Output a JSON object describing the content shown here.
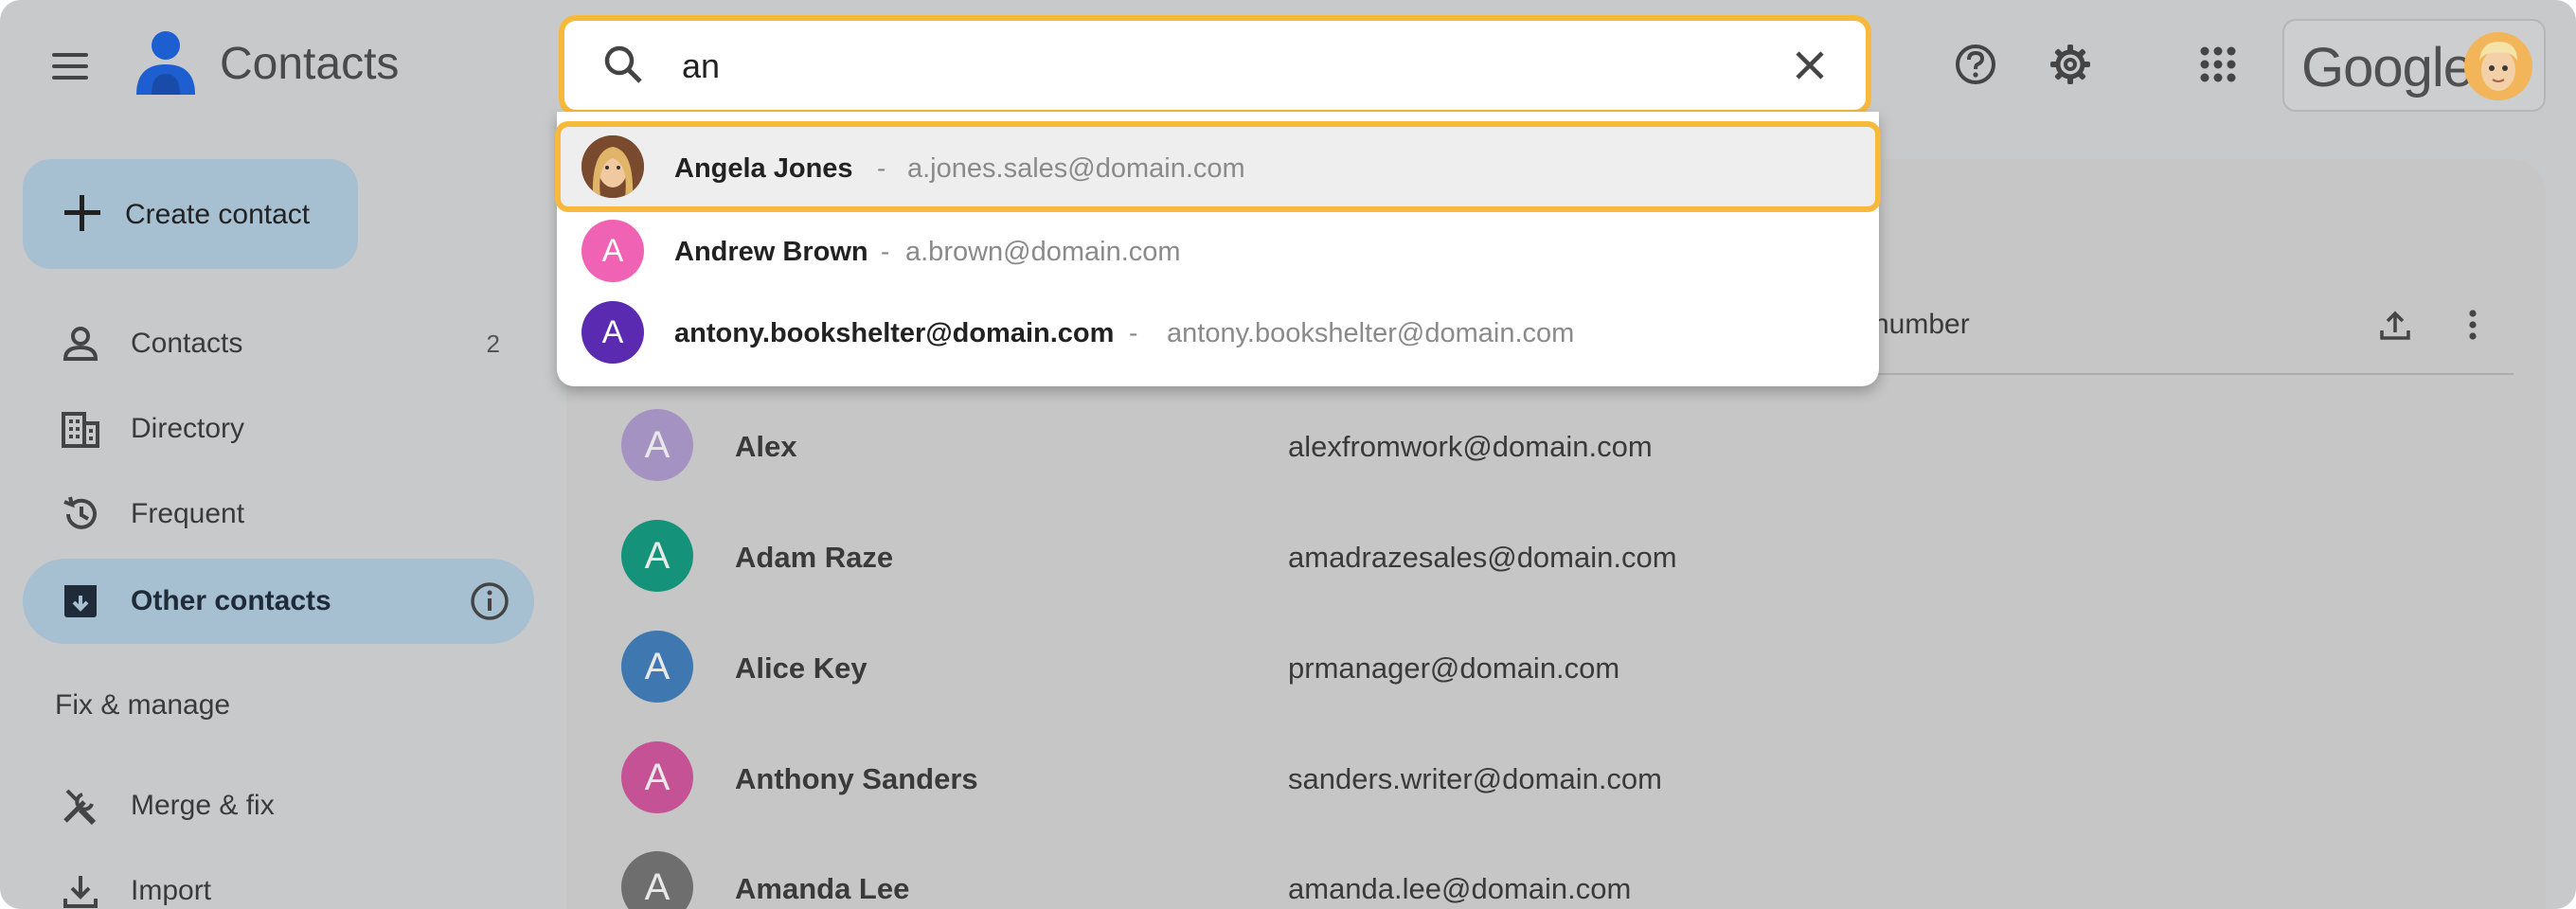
{
  "app": {
    "title": "Contacts"
  },
  "header": {
    "google_label": "Google"
  },
  "search": {
    "value": "an"
  },
  "suggestions": [
    {
      "name": "Angela Jones",
      "separator": "-",
      "email": "a.jones.sales@domain.com",
      "avatar": "photo",
      "highlighted": true
    },
    {
      "name": "Andrew Brown",
      "separator": "-",
      "email": "a.brown@domain.com",
      "initial": "A",
      "color": "#f062b4"
    },
    {
      "name": "antony.bookshelter@domain.com",
      "separator": "-",
      "email": "antony.bookshelter@domain.com",
      "initial": "A",
      "color": "#5a2bb0"
    }
  ],
  "sidebar": {
    "create_label": "Create contact",
    "items": [
      {
        "label": "Contacts",
        "count": "2",
        "icon": "person-icon"
      },
      {
        "label": "Directory",
        "icon": "building-icon"
      },
      {
        "label": "Frequent",
        "icon": "history-icon"
      },
      {
        "label": "Other contacts",
        "icon": "archive-download-icon",
        "active": true
      }
    ],
    "section_label": "Fix & manage",
    "manage_items": [
      {
        "label": "Merge & fix",
        "icon": "tools-icon"
      },
      {
        "label": "Import",
        "icon": "download-icon"
      }
    ]
  },
  "list": {
    "column_header_partial": "number",
    "rows": [
      {
        "initial": "A",
        "name": "Alex",
        "email": "alexfromwork@domain.com",
        "color": "#a493c2"
      },
      {
        "initial": "A",
        "name": "Adam Raze",
        "email": "amadrazesales@domain.com",
        "color": "#15927a"
      },
      {
        "initial": "A",
        "name": "Alice Key",
        "email": "prmanager@domain.com",
        "color": "#3f78b0"
      },
      {
        "initial": "A",
        "name": "Anthony Sanders",
        "email": "sanders.writer@domain.com",
        "color": "#c45294"
      },
      {
        "initial": "A",
        "name": "Amanda Lee",
        "email": "amanda.lee@domain.com",
        "color": "#6e6e6e"
      }
    ]
  },
  "colors": {
    "accent_highlight": "#f6b93b",
    "active_nav": "#a6bfd1"
  }
}
